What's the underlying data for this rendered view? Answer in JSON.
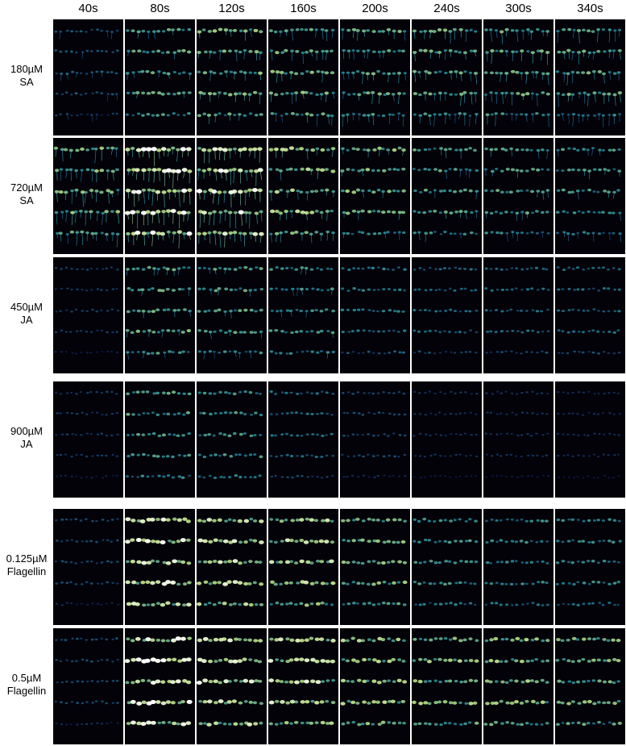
{
  "time_labels": [
    "40s",
    "80s",
    "120s",
    "160s",
    "200s",
    "240s",
    "300s",
    "340s"
  ],
  "treatments": [
    {
      "line1": "180µM",
      "line2": "SA",
      "response": [
        0.25,
        0.55,
        0.6,
        0.6,
        0.55,
        0.55,
        0.55,
        0.55
      ],
      "roots": [
        0.2,
        0.2,
        0.45,
        0.5,
        0.55,
        0.6,
        0.65,
        0.65
      ]
    },
    {
      "line1": "720µM",
      "line2": "SA",
      "response": [
        0.6,
        1.0,
        0.9,
        0.7,
        0.6,
        0.5,
        0.5,
        0.45
      ],
      "roots": [
        0.8,
        1.0,
        0.9,
        0.4,
        0.3,
        0.3,
        0.3,
        0.3
      ]
    },
    {
      "line1": "450µM",
      "line2": "JA",
      "response": [
        0.15,
        0.55,
        0.5,
        0.45,
        0.35,
        0.3,
        0.3,
        0.3
      ],
      "roots": [
        0.1,
        0.2,
        0.2,
        0.2,
        0.15,
        0.15,
        0.15,
        0.15
      ]
    },
    {
      "line1": "900µM",
      "line2": "JA",
      "response": [
        0.15,
        0.5,
        0.45,
        0.3,
        0.2,
        0.12,
        0.12,
        0.1
      ],
      "roots": [
        0.1,
        0.15,
        0.15,
        0.15,
        0.15,
        0.1,
        0.1,
        0.1
      ]
    },
    {
      "line1": "0.125µM",
      "line2": "Flagellin",
      "response": [
        0.2,
        0.85,
        0.8,
        0.75,
        0.6,
        0.45,
        0.4,
        0.4
      ],
      "roots": [
        0.05,
        0.1,
        0.1,
        0.1,
        0.1,
        0.1,
        0.1,
        0.1
      ]
    },
    {
      "line1": "0.5µM",
      "line2": "Flagellin",
      "response": [
        0.2,
        0.95,
        0.85,
        0.8,
        0.7,
        0.65,
        0.65,
        0.6
      ],
      "roots": [
        0.05,
        0.1,
        0.1,
        0.1,
        0.1,
        0.1,
        0.1,
        0.1
      ]
    }
  ],
  "colors": {
    "background": "#020208",
    "low": "#1a2a8c",
    "mid": "#2fb5c8",
    "high": "#c8f08a",
    "peak": "#ffffff"
  }
}
